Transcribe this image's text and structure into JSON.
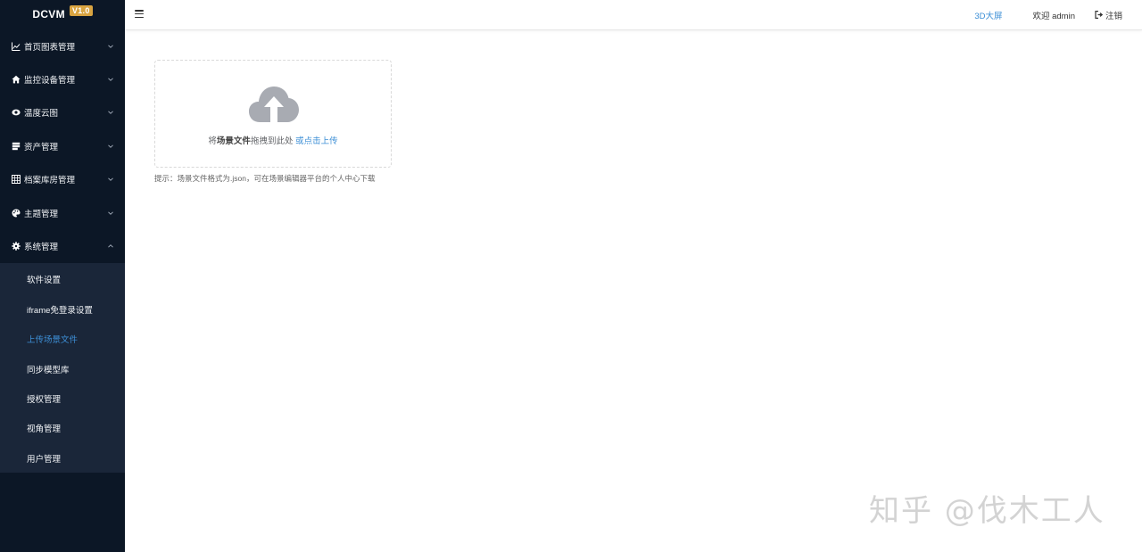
{
  "app": {
    "name": "DCVM",
    "version": "V1.0"
  },
  "sidebar": {
    "items": [
      {
        "label": "首页图表管理",
        "icon": "line-chart-icon"
      },
      {
        "label": "监控设备管理",
        "icon": "home-icon"
      },
      {
        "label": "温度云图",
        "icon": "eye-icon"
      },
      {
        "label": "资产管理",
        "icon": "server-icon"
      },
      {
        "label": "档案库房管理",
        "icon": "grid-icon"
      },
      {
        "label": "主题管理",
        "icon": "palette-icon"
      },
      {
        "label": "系统管理",
        "icon": "gear-icon",
        "expanded": true
      }
    ],
    "submenu": [
      {
        "label": "软件设置"
      },
      {
        "label": "iframe免登录设置"
      },
      {
        "label": "上传场景文件",
        "active": true
      },
      {
        "label": "同步模型库"
      },
      {
        "label": "授权管理"
      },
      {
        "label": "视角管理"
      },
      {
        "label": "用户管理"
      }
    ]
  },
  "header": {
    "link_3d": "3D大屏",
    "welcome": "欢迎 admin",
    "logout": "注销"
  },
  "upload": {
    "text_prefix": "将",
    "text_emphasis": "场景文件",
    "text_middle": "拖拽到此处 ",
    "text_click": "或点击上传",
    "tip": "提示：场景文件格式为.json，可在场景编辑器平台的个人中心下载"
  },
  "watermark": "知乎 @伐木工人",
  "colors": {
    "sidebar_bg": "#0c1726",
    "submenu_bg": "#1a2639",
    "accent": "#3d8fd6",
    "badge": "#d9a441"
  }
}
